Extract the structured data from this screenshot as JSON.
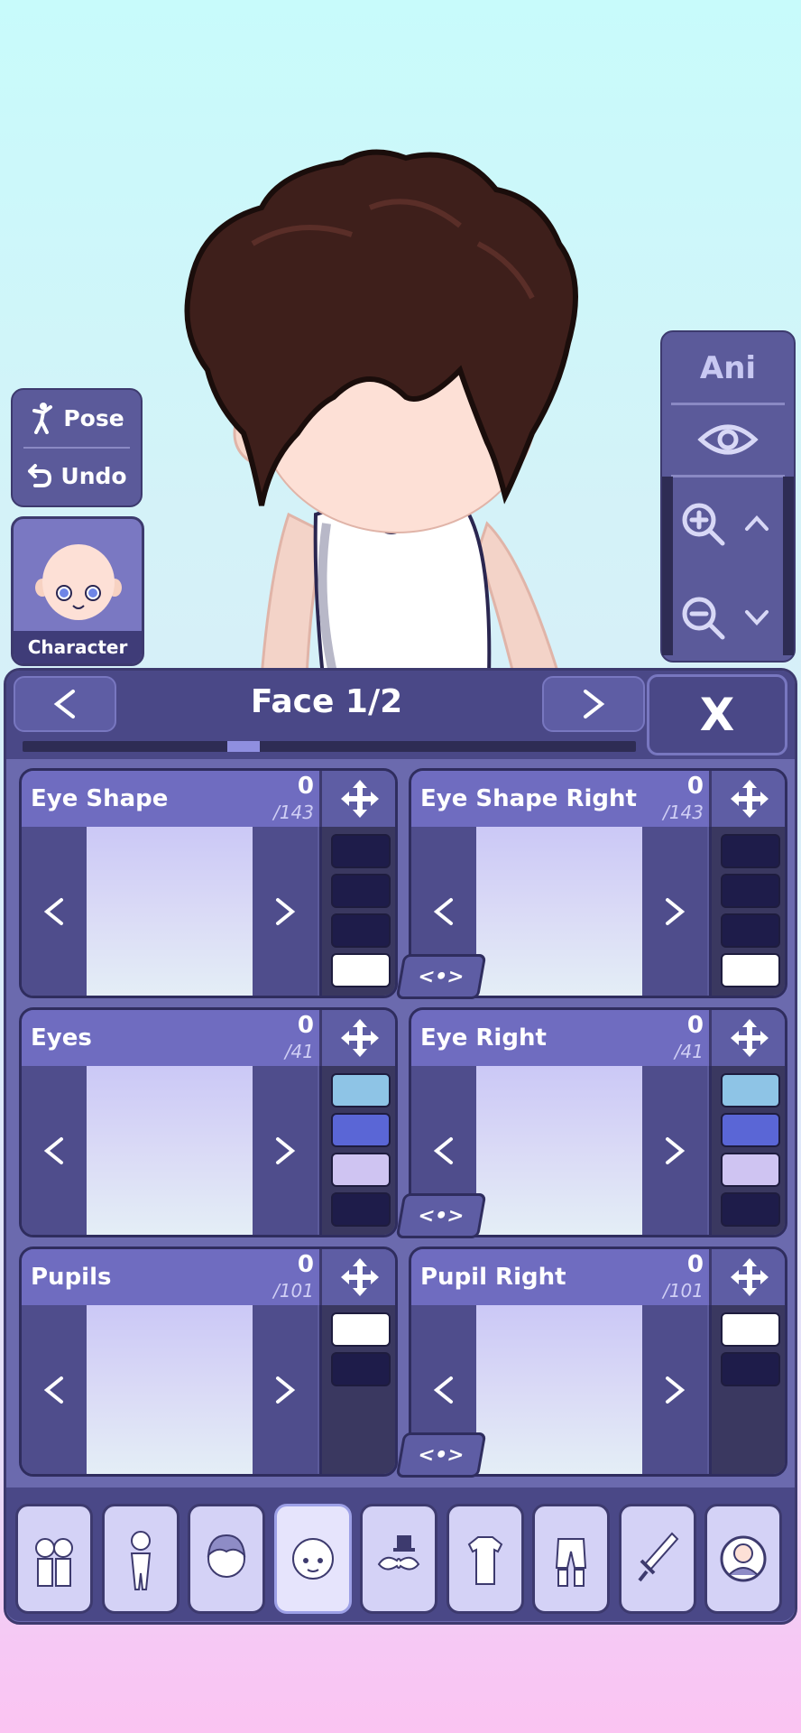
{
  "left_panel": {
    "pose_label": "Pose",
    "undo_label": "Undo",
    "character_label": "Character"
  },
  "right_panel": {
    "ani_label": "Ani"
  },
  "main_panel": {
    "title": "Face 1/2",
    "close_label": "X",
    "progress_value": 0.36,
    "cards": [
      {
        "title": "Eye Shape",
        "count": "0",
        "total": "/143",
        "swatches": [
          "#1e1c4a",
          "#1e1c4a",
          "#1e1c4a",
          "#ffffff"
        ],
        "sync": false
      },
      {
        "title": "Eye Shape Right",
        "count": "0",
        "total": "/143",
        "swatches": [
          "#1e1c4a",
          "#1e1c4a",
          "#1e1c4a",
          "#ffffff"
        ],
        "sync": true
      },
      {
        "title": "Eyes",
        "count": "0",
        "total": "/41",
        "swatches": [
          "#8ec4e6",
          "#5a66d6",
          "#cfc4f2",
          "#1e1c4a"
        ],
        "sync": false
      },
      {
        "title": "Eye Right",
        "count": "0",
        "total": "/41",
        "swatches": [
          "#8ec4e6",
          "#5a66d6",
          "#cfc4f2",
          "#1e1c4a"
        ],
        "sync": true
      },
      {
        "title": "Pupils",
        "count": "0",
        "total": "/101",
        "swatches": [
          "#ffffff",
          "#1e1c4a"
        ],
        "sync": false
      },
      {
        "title": "Pupil Right",
        "count": "0",
        "total": "/101",
        "swatches": [
          "#ffffff",
          "#1e1c4a"
        ],
        "sync": true
      }
    ],
    "sync_label": "<•>",
    "categories": [
      {
        "icon": "presets-icon"
      },
      {
        "icon": "body-icon"
      },
      {
        "icon": "hair-icon"
      },
      {
        "icon": "face-icon",
        "active": true
      },
      {
        "icon": "accessories-icon"
      },
      {
        "icon": "top-icon"
      },
      {
        "icon": "bottom-icon"
      },
      {
        "icon": "weapons-icon"
      },
      {
        "icon": "profile-icon"
      }
    ]
  },
  "colors": {
    "panel": "#6b6aae",
    "panel_dark": "#4a4887",
    "border": "#3d3a6e",
    "preview_top": "#cbc8f6"
  }
}
